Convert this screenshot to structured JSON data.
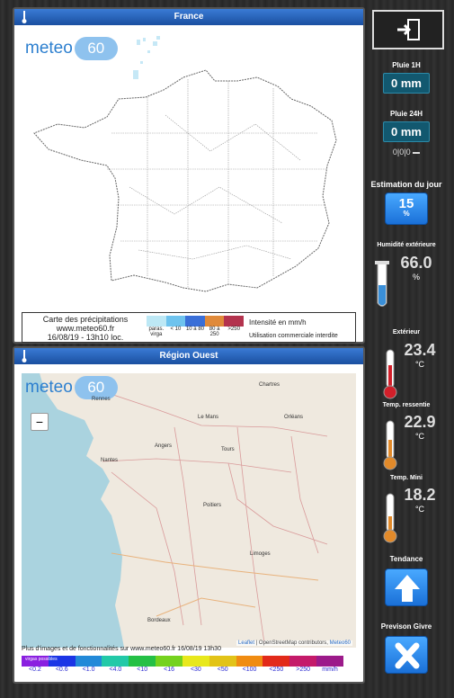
{
  "panel_france": {
    "title": "France",
    "logo_text": "meteo",
    "logo_badge": "60",
    "caption_line1": "Carte des précipitations",
    "caption_line2": "www.meteo60.fr",
    "caption_line3": "16/08/19 - 13h10 loc.",
    "scale_colors": [
      "#bde8f5",
      "#6ec3ee",
      "#3a6fd8",
      "#e08a3a",
      "#b3334e"
    ],
    "scale_labels": [
      "paras. virga",
      "< 10",
      "10 à 80",
      "80 à 250",
      ">250"
    ],
    "intensity_label": "Intensité en mm/h",
    "usage_label": "Utilisation commerciale interdite"
  },
  "panel_ouest": {
    "title": "Région Ouest",
    "zoom_minus": "−",
    "attribution_leaflet": "Leaflet",
    "attribution_rest": " | OpenStreetMap contributors, ",
    "attribution_meteo": "Meteo60",
    "footer_text": "Plus d'images et de fonctionnalités sur www.meteo60.fr 16/08/19 13h30",
    "virga_label": "virgas possibles",
    "precip_colors": [
      "#8a1fe0",
      "#1b35e6",
      "#2289d8",
      "#22c9a8",
      "#24c046",
      "#75d21e",
      "#e8e81c",
      "#e2c318",
      "#f08c12",
      "#e22a1a",
      "#c41a6a",
      "#9c1a8a"
    ],
    "precip_labels": [
      "<0.2",
      "<0.6",
      "<1.0",
      "<4.0",
      "<10",
      "<16",
      "<30",
      "<50",
      "<100",
      "<250",
      ">250",
      "mm/h"
    ],
    "cities": [
      "Rennes",
      "Chartres",
      "Le Mans",
      "Orléans",
      "Angers",
      "Nantes",
      "Tours",
      "Poitiers",
      "Limoges",
      "Bordeaux"
    ]
  },
  "sidebar": {
    "pluie_1h_label": "Pluie 1H",
    "pluie_1h_value": "0 mm",
    "pluie_24h_label": "Pluie 24H",
    "pluie_24h_value": "0 mm",
    "trend_small": "0|0|0",
    "estimation_label": "Estimation du jour",
    "estimation_value": "15",
    "estimation_unit": "%",
    "humidity_label": "Humidité extérieure",
    "humidity_value": "66.0",
    "humidity_unit": "%",
    "exterieur_label": "Extérieur",
    "exterieur_value": "23.4",
    "exterieur_unit": "°C",
    "ressentie_label": "Temp. ressentie",
    "ressentie_value": "22.9",
    "ressentie_unit": "°C",
    "mini_label": "Temp. Mini",
    "mini_value": "18.2",
    "mini_unit": "°C",
    "tendance_label": "Tendance",
    "givre_label": "Previson Givre"
  }
}
